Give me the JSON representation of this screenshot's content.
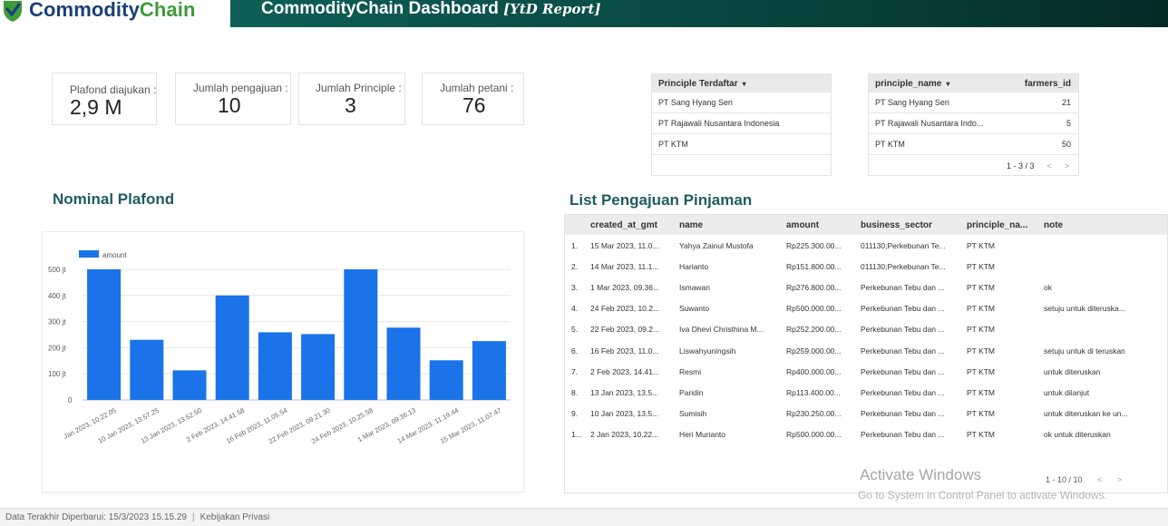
{
  "header": {
    "logo_part1": "Commodity",
    "logo_part2": "Chain",
    "title": "CommodityChain Dashboard ",
    "title_suffix": "[YtD Report]",
    "colors": {
      "logo_blue": "#1a3f7a",
      "logo_green": "#3f9b3a",
      "title_bar": "#0a4d47"
    }
  },
  "kpis": [
    {
      "label": "Plafond diajukan :",
      "value": "2,9 M"
    },
    {
      "label": "Jumlah pengajuan :",
      "value": "10"
    },
    {
      "label": "Jumlah Principle :",
      "value": "3"
    },
    {
      "label": "Jumlah petani :",
      "value": "76"
    }
  ],
  "principle_table": {
    "header": "Principle Terdaftar",
    "sort_icon": "▾",
    "rows": [
      "PT Sang Hyang Seri",
      "PT Rajawali Nusantara Indonesia",
      "PT KTM"
    ]
  },
  "farmers_table": {
    "header_name": "principle_name",
    "sort_icon": "▾",
    "header_value": "farmers_id",
    "rows": [
      {
        "name": "PT Sang Hyang Seri",
        "value": "21"
      },
      {
        "name": "PT Rajawali Nusantara Indo...",
        "value": "5"
      },
      {
        "name": "PT KTM",
        "value": "50"
      }
    ],
    "pager": "1 - 3 / 3",
    "prev": "<",
    "next": ">"
  },
  "chart_section": {
    "title": "Nominal Plafond"
  },
  "chart_data": {
    "type": "bar",
    "legend": [
      "amount"
    ],
    "legend_position": "top-left",
    "bar_color": "#1a73e8",
    "categories": [
      "10 Jan 2023, 10.22.05",
      "10 Jan 2023, 13.57.25",
      "13 Jan 2023, 13.52.50",
      "2 Feb 2023, 14.41.58",
      "16 Feb 2023, 11.05.54",
      "22 Feb 2023, 09.21.30",
      "24 Feb 2023, 10.25.58",
      "1 Mar 2023, 09.36.13",
      "14 Mar 2023, 11.19.44",
      "15 Mar 2023, 11.07.47"
    ],
    "tick_labels_shown": [
      "Jan 2023, 10.22.05",
      "10 Jan 2023, 13.57.25",
      "13 Jan 2023, 13.52.50",
      "2 Feb 2023, 14.41.58",
      "16 Feb 2023, 11.05.54",
      "22 Feb 2023, 09.21.30",
      "24 Feb 2023, 10.25.58",
      "1 Mar 2023, 09.36.13",
      "14 Mar 2023, 11.19.44",
      "15 Mar 2023, 11.07.47"
    ],
    "series": [
      {
        "name": "amount",
        "values": [
          500000000,
          230250000,
          113400000,
          400000000,
          259000000,
          252200000,
          500000000,
          276800000,
          151800000,
          225300000
        ]
      }
    ],
    "y_ticks": [
      "0",
      "100 jt",
      "200 jt",
      "300 jt",
      "400 jt",
      "500 jt"
    ],
    "ylim": [
      0,
      500000000
    ],
    "grid": true
  },
  "list_section": {
    "title": "List Pengajuan Pinjaman",
    "columns": [
      "created_at_gmt",
      "name",
      "amount",
      "business_sector",
      "principle_na...",
      "note"
    ],
    "rows": [
      {
        "idx": "1.",
        "date": "15 Mar 2023, 11.0...",
        "name": "Yahya Zainul Mustofa",
        "amount": "Rp225.300.00...",
        "sector": "011130;Perkebunan Te...",
        "principle": "PT KTM",
        "note": ""
      },
      {
        "idx": "2.",
        "date": "14 Mar 2023, 11.1...",
        "name": "Harianto",
        "amount": "Rp151.800.00...",
        "sector": "011130;Perkebunan Te...",
        "principle": "PT KTM",
        "note": ""
      },
      {
        "idx": "3.",
        "date": "1 Mar 2023, 09.36...",
        "name": "Ismawan",
        "amount": "Rp276.800.00...",
        "sector": "Perkebunan Tebu dan ...",
        "principle": "PT KTM",
        "note": "ok"
      },
      {
        "idx": "4.",
        "date": "24 Feb 2023, 10.2...",
        "name": "Suwanto",
        "amount": "Rp500.000.00...",
        "sector": "Perkebunan Tebu dan ...",
        "principle": "PT KTM",
        "note": "setuju untuk diteruska..."
      },
      {
        "idx": "5.",
        "date": "22 Feb 2023, 09.2...",
        "name": "Iva Dhevi Christhina M...",
        "amount": "Rp252.200.00...",
        "sector": "Perkebunan Tebu dan ...",
        "principle": "PT KTM",
        "note": ""
      },
      {
        "idx": "6.",
        "date": "16 Feb 2023, 11.0...",
        "name": "Liswahyuningsih",
        "amount": "Rp259.000.00...",
        "sector": "Perkebunan Tebu dan ...",
        "principle": "PT KTM",
        "note": "setuju untuk di teruskan"
      },
      {
        "idx": "7.",
        "date": "2 Feb 2023, 14.41...",
        "name": "Resmi",
        "amount": "Rp400.000.00...",
        "sector": "Perkebunan Tebu dan ...",
        "principle": "PT KTM",
        "note": "untuk diteruskan"
      },
      {
        "idx": "8.",
        "date": "13 Jan 2023, 13.5...",
        "name": "Paridin",
        "amount": "Rp113.400.00...",
        "sector": "Perkebunan Tebu dan ...",
        "principle": "PT KTM",
        "note": "untuk dilanjut"
      },
      {
        "idx": "9.",
        "date": "10 Jan 2023, 13.5...",
        "name": "Sumisih",
        "amount": "Rp230.250.00...",
        "sector": "Perkebunan Tebu dan ...",
        "principle": "PT KTM",
        "note": "untuk diteruskan ke un..."
      },
      {
        "idx": "1...",
        "date": "2 Jan 2023, 10.22...",
        "name": "Heri Murianto",
        "amount": "Rp500.000.00...",
        "sector": "Perkebunan Tebu dan ...",
        "principle": "PT KTM",
        "note": "ok untuk diteruskan"
      }
    ],
    "pager": "1 - 10 / 10",
    "prev": "<",
    "next": ">"
  },
  "watermark": {
    "line1": "Activate Windows",
    "line2": "Go to System in Control Panel to activate Windows."
  },
  "footer": {
    "updated": "Data Terakhir Diperbarui: 15/3/2023 15.15.29",
    "separator": "|",
    "privacy": "Kebijakan Privasi"
  }
}
